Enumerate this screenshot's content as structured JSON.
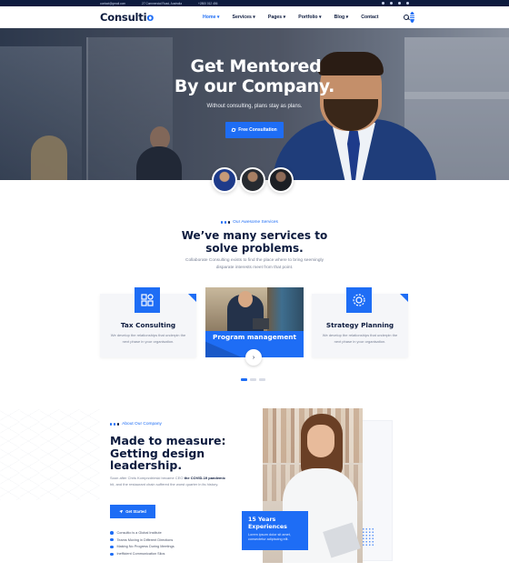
{
  "topbar": {
    "email": "contact@gmail.com",
    "address": "27 Commercial Road, Australia",
    "phone": "+2800 012 456"
  },
  "header": {
    "logo_main": "Consulti",
    "logo_accent": "o",
    "nav": [
      "Home ▾",
      "Services ▾",
      "Pages ▾",
      "Portfolio ▾",
      "Blog ▾",
      "Contact"
    ]
  },
  "hero": {
    "title_line1": "Get Mentored",
    "title_line2": "By our Company.",
    "subtitle": "Without consulting, plans stay as plans.",
    "cta": "Free Consultation"
  },
  "services": {
    "eyebrow": "Our Awesome Services",
    "title_line1": "We’ve many services to",
    "title_line2": "solve problems.",
    "desc_line1": "Collaborate Consulting exists to find the place where to bring seemingly",
    "desc_line2": "disparate interests meet from that point.",
    "cards": [
      {
        "title": "Tax Consulting",
        "desc": "We develop the relationships that underpin the next phase in your organisation."
      },
      {
        "title": "Program management",
        "arrow": "›"
      },
      {
        "title": "Strategy Planning",
        "desc": "We develop the relationships that underpin the next phase in your organisation."
      }
    ]
  },
  "about": {
    "eyebrow": "About Our Company",
    "title_line1": "Made to measure:",
    "title_line2": "Getting design",
    "title_line3": "leadership.",
    "text_a": "Soon after Chris Komprzdrieski became CEO ",
    "text_b": "the COVID-19 pandemic",
    "text_c": " hit, and the restaurant chain suffered the worst quarter in its history.",
    "cta": "Get Started",
    "checklist": [
      "Consultio is a Global Institute",
      "Teams Moving in Different Directions",
      "Making No Progress During Meetings",
      "Inefficient Communication Silos"
    ],
    "experience_line1": "15 Years",
    "experience_line2": "Experiences",
    "experience_desc": "Lorem ipsum dolor sit amet, consectetur adipiscing elit."
  }
}
